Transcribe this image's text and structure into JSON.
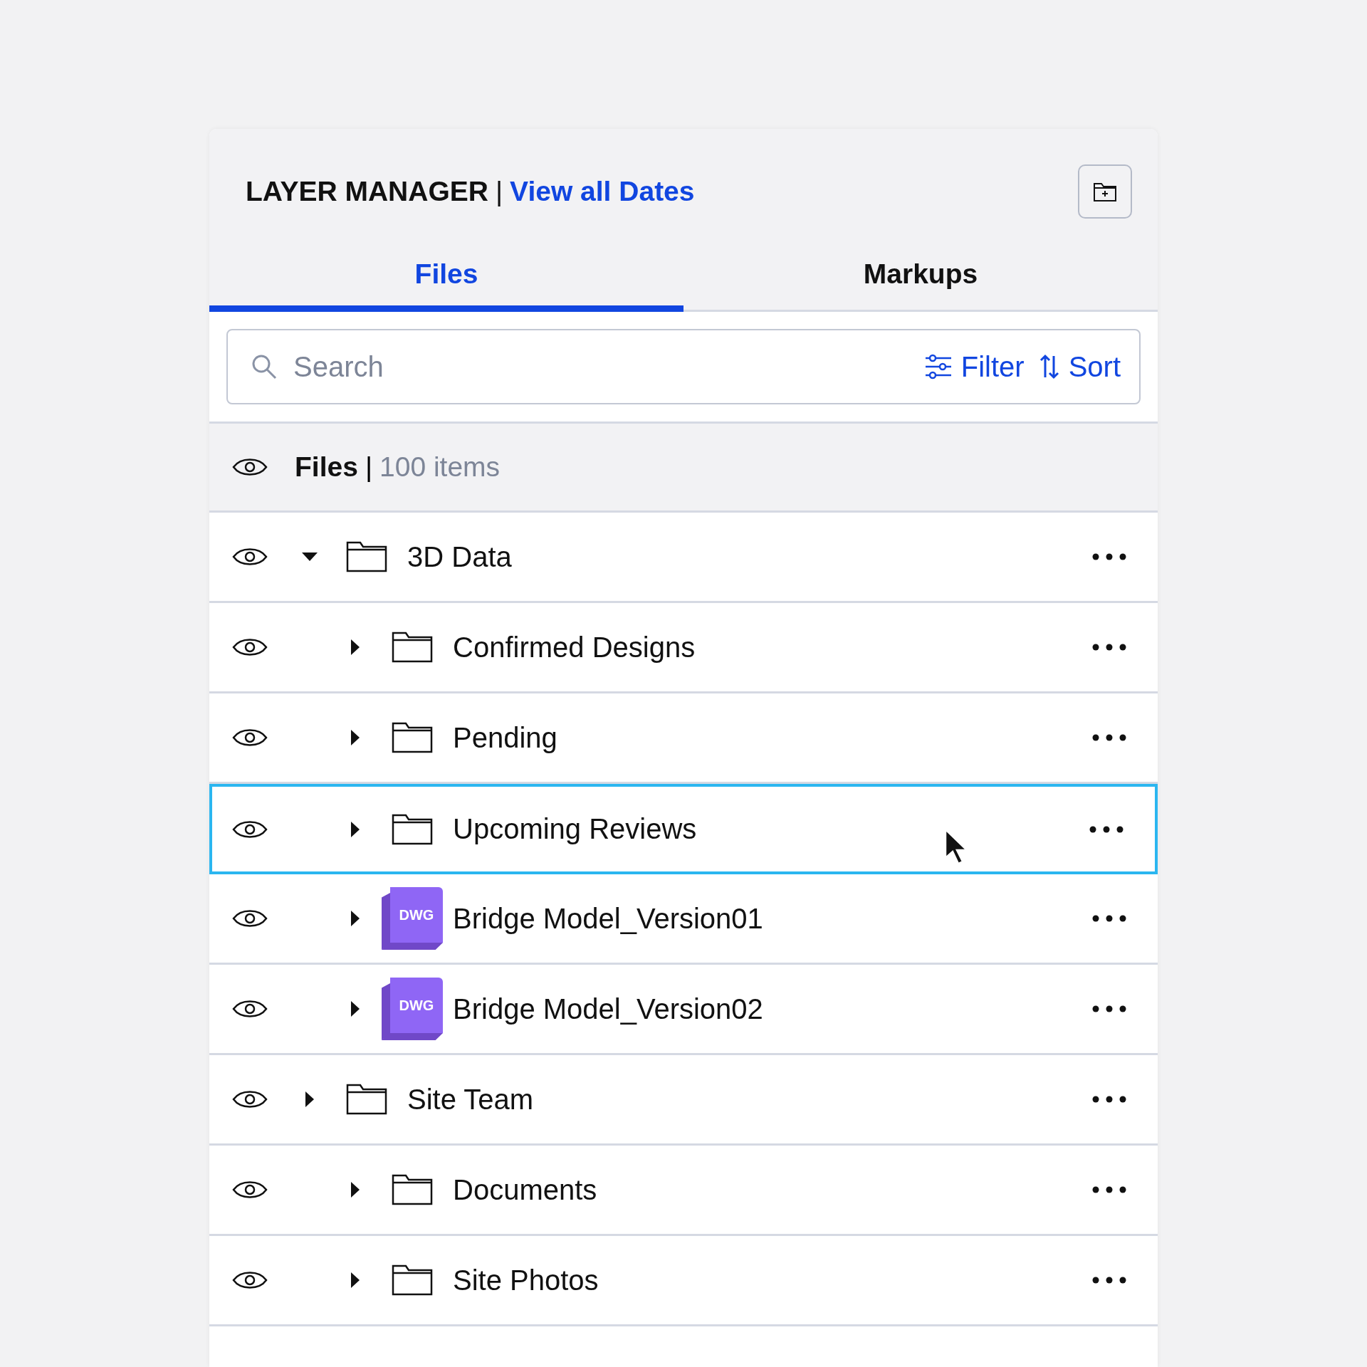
{
  "header": {
    "title": "LAYER MANAGER",
    "separator": "|",
    "link": "View all Dates"
  },
  "tabs": [
    {
      "label": "Files",
      "selected": true
    },
    {
      "label": "Markups",
      "selected": false
    }
  ],
  "search": {
    "placeholder": "Search",
    "filter": "Filter",
    "sort": "Sort"
  },
  "section": {
    "title": "Files",
    "separator": "|",
    "count": "100 items"
  },
  "tree": [
    {
      "kind": "folder",
      "name": "3D Data",
      "expanded": true,
      "selected": false,
      "children": [
        {
          "kind": "folder",
          "name": "Confirmed Designs",
          "expanded": false,
          "selected": false
        },
        {
          "kind": "folder",
          "name": "Pending",
          "expanded": false,
          "selected": false
        },
        {
          "kind": "folder",
          "name": "Upcoming Reviews",
          "expanded": false,
          "selected": true
        },
        {
          "kind": "dwg",
          "badge": "DWG",
          "name": "Bridge Model_Version01",
          "expanded": false,
          "selected": false
        },
        {
          "kind": "dwg",
          "badge": "DWG",
          "name": "Bridge Model_Version02",
          "expanded": false,
          "selected": false
        }
      ]
    },
    {
      "kind": "folder",
      "name": "Site Team",
      "expanded": false,
      "selected": false,
      "children": [
        {
          "kind": "folder",
          "name": "Documents",
          "expanded": false,
          "selected": false
        },
        {
          "kind": "folder",
          "name": "Site Photos",
          "expanded": false,
          "selected": false
        }
      ]
    }
  ]
}
